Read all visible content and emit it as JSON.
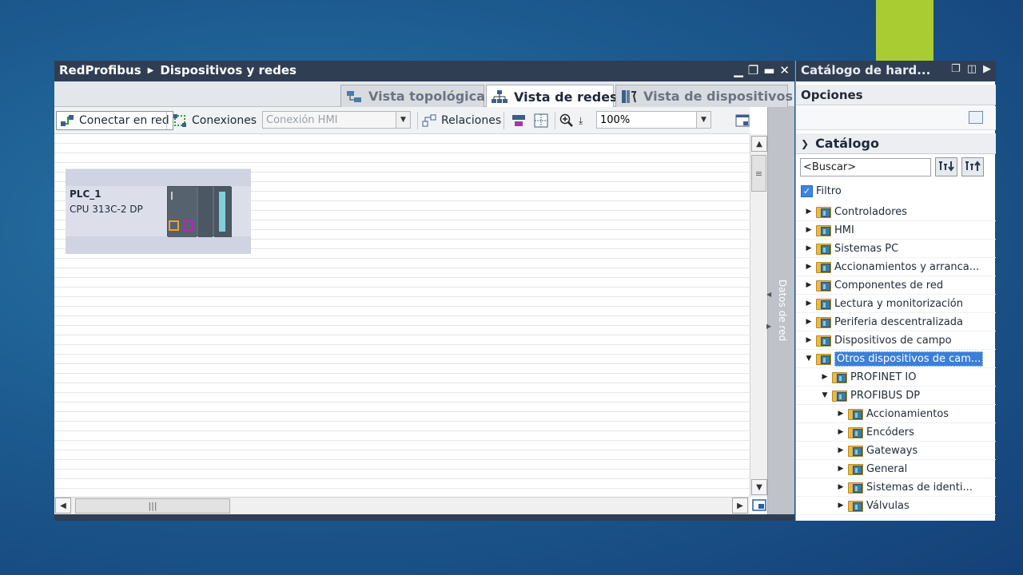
{
  "window": {
    "breadcrumb": [
      "RedProfibus",
      "Dispositivos y redes"
    ],
    "controls": [
      "▁",
      "❐",
      "▬",
      "✕"
    ]
  },
  "tabs": [
    {
      "label": "Vista topológica",
      "icon": "topology-icon",
      "active": false
    },
    {
      "label": "Vista de redes",
      "icon": "network-icon",
      "active": true
    },
    {
      "label": "Vista de dispositivos",
      "icon": "device-icon",
      "active": false
    }
  ],
  "toolbar": {
    "connect_label": "Conectar en red",
    "connections_label": "Conexiones",
    "connection_type": "Conexión HMI",
    "relations_label": "Relaciones",
    "zoom": "100%"
  },
  "plc": {
    "name": "PLC_1",
    "type": "CPU 313C-2 DP"
  },
  "side_tab": "Datos de red",
  "catalog": {
    "title": "Catálogo de hard...",
    "options_label": "Opciones",
    "section_label": "Catálogo",
    "search_value": "<Buscar>",
    "filter_label": "Filtro",
    "filter_checked": true,
    "tree": [
      {
        "label": "Controladores",
        "level": 0,
        "expanded": false
      },
      {
        "label": "HMI",
        "level": 0,
        "expanded": false
      },
      {
        "label": "Sistemas PC",
        "level": 0,
        "expanded": false
      },
      {
        "label": "Accionamientos y arranca...",
        "level": 0,
        "expanded": false
      },
      {
        "label": "Componentes de red",
        "level": 0,
        "expanded": false
      },
      {
        "label": "Lectura y monitorización",
        "level": 0,
        "expanded": false
      },
      {
        "label": "Periferia descentralizada",
        "level": 0,
        "expanded": false
      },
      {
        "label": "Dispositivos de campo",
        "level": 0,
        "expanded": false
      },
      {
        "label": "Otros dispositivos de cam...",
        "level": 0,
        "expanded": true,
        "selected": true
      },
      {
        "label": "PROFINET IO",
        "level": 1,
        "expanded": false
      },
      {
        "label": "PROFIBUS DP",
        "level": 1,
        "expanded": true
      },
      {
        "label": "Accionamientos",
        "level": 2,
        "expanded": false
      },
      {
        "label": "Encóders",
        "level": 2,
        "expanded": false
      },
      {
        "label": "Gateways",
        "level": 2,
        "expanded": false
      },
      {
        "label": "General",
        "level": 2,
        "expanded": false
      },
      {
        "label": "Sistemas de identi...",
        "level": 2,
        "expanded": false
      },
      {
        "label": "Válvulas",
        "level": 2,
        "expanded": false
      }
    ]
  },
  "colors": {
    "titlebar": "#2f3e53",
    "accent_green": "#a8cc32",
    "selection": "#3b7fd6",
    "background": "#1d5c90"
  }
}
